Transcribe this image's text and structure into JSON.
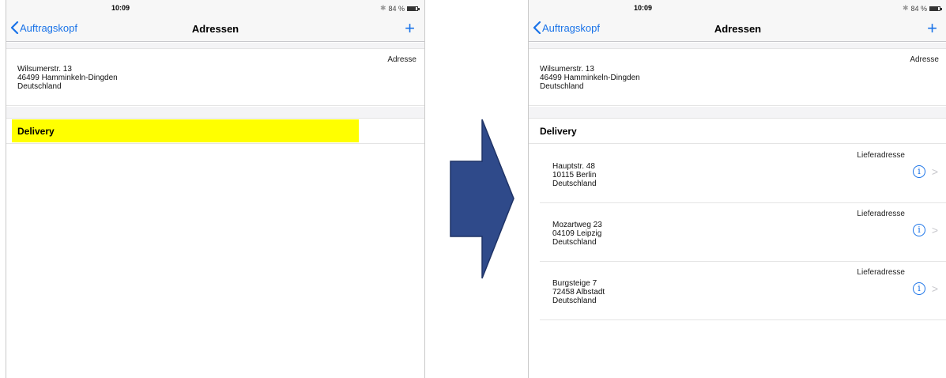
{
  "status_bar": {
    "time": "10:09",
    "battery": "84 %",
    "battery_level": 0.84
  },
  "nav": {
    "back_label": "Auftragskopf",
    "title": "Adressen",
    "add_label": "+"
  },
  "main_address": {
    "type": "Adresse",
    "lines": [
      "Wilsumerstr. 13",
      "46499 Hamminkeln-Dingden",
      "Deutschland"
    ]
  },
  "delivery_section": {
    "label": "Delivery",
    "highlight_color": "#ffff00"
  },
  "delivery_addresses": [
    {
      "type": "Lieferadresse",
      "street": "Hauptstr. 48",
      "city": "10115 Berlin",
      "country": "Deutschland"
    },
    {
      "type": "Lieferadresse",
      "street": "Mozartweg 23",
      "city": "04109 Leipzig",
      "country": "Deutschland"
    },
    {
      "type": "Lieferadresse",
      "street": "Burgsteige 7",
      "city": "72458 Albstadt",
      "country": "Deutschland"
    }
  ],
  "icons": {
    "back": "chevron-left-icon",
    "add": "plus-icon",
    "info": "info-circle-icon",
    "disclosure": "chevron-right-icon",
    "bluetooth": "bluetooth-icon",
    "battery": "battery-icon",
    "transition": "right-arrow-icon"
  },
  "colors": {
    "accent": "#1a73e8",
    "arrow_fill": "#2f4a8a",
    "arrow_stroke": "#1f3366"
  }
}
